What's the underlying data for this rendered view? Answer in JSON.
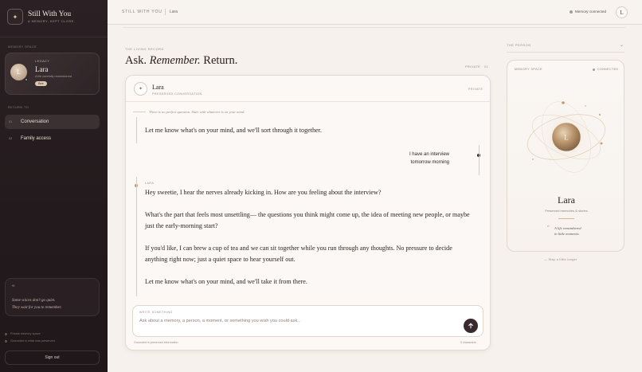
{
  "brand": {
    "title": "Still With You",
    "subtitle": "A MEMORY, KEPT CLOSE.",
    "mark": "✦"
  },
  "sidebar": {
    "memory_space_label": "MEMORY SPACE",
    "memory_card": {
      "eyebrow": "LEGACY",
      "name": "Lara",
      "initial": "L",
      "description": "A life carefully remembered",
      "badge": "Bee"
    },
    "return_label": "RETURN TO",
    "nav": [
      {
        "num": "01",
        "label": "Conversation",
        "active": true
      },
      {
        "num": "02",
        "label": "Family access",
        "active": false
      }
    ],
    "quote": {
      "mark": "“",
      "line1": "Some voices don't go quiet.",
      "line2": "They wait for you to remember."
    },
    "meta": [
      "Private memory space",
      "Grounded in what was preserved"
    ],
    "signout_label": "Sign out"
  },
  "topbar": {
    "title": "STILL WITH YOU",
    "person": "Lara",
    "status": "Memory connected",
    "avatar_initial": "L"
  },
  "main": {
    "eyebrow": "THE LIVING RECORD",
    "headline": {
      "part1": "Ask.",
      "part2": "Remember.",
      "part3": "Return."
    },
    "private_count": "PRIVATE · 01"
  },
  "chat": {
    "header": {
      "name": "Lara",
      "subtitle": "PRESERVED CONVERSATION",
      "private": "PRIVATE",
      "icon": "✦"
    },
    "hint": "There is no perfect question. Start with whatever is on your mind.",
    "intro": "Let me know what's on your mind, and we'll sort through it together.",
    "user_message": {
      "line1": "I have an interview",
      "line2": "tomorrow morning"
    },
    "lara_label": "LARA",
    "reply": [
      "Hey sweetie, I hear the nerves already kicking in. How are you feeling about the interview?",
      "What's the part that feels most unsettling— the questions you think might come up, the idea of meeting new people, or maybe just the early-morning start?",
      "If you'd like, I can brew a cup of tea and we can sit together while you run through any thoughts. No pressure to decide anything right now; just a quiet space to hear yourself out.",
      "Let me know what's on your mind, and we'll take it from there."
    ],
    "composer": {
      "label": "WRITE SOMETHING",
      "placeholder": "Ask about a memory, a person, a moment, or something you wish you could ask...",
      "send_icon": "arrow-up-icon"
    },
    "footer_left": "Grounded in preserved information",
    "footer_right": "0 characters"
  },
  "person_panel": {
    "label": "THE PERSON",
    "space_label": "MEMORY SPACE",
    "connected": "CONNECTED",
    "initial": "L",
    "name": "Lara",
    "subtitle": "Preserved memories & stories",
    "quote_mark": "“",
    "quote_line1": "A life remembered",
    "quote_line2": "in little moments",
    "footer": "— Stay a little longer"
  },
  "colors": {
    "accent": "#c49a6b",
    "sidebar_bg": "#2b2124",
    "send_button": "#3a2a2d"
  }
}
